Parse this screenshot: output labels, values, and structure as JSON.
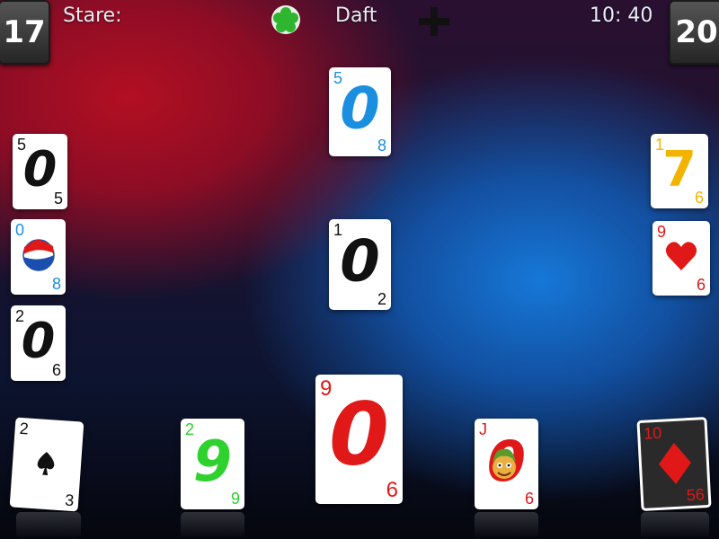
{
  "header": {
    "status_label": "Stare:",
    "player_name": "Daft",
    "clock": "10: 40"
  },
  "scores": {
    "left": "17",
    "right": "20"
  },
  "icons": {
    "status": "green-flower-icon",
    "add": "plus-icon"
  },
  "colors": {
    "black": "#111111",
    "blue": "#1a8fe0",
    "red": "#e01818",
    "green": "#2ed12e",
    "yellow": "#f2b400"
  },
  "cards": {
    "top_center": {
      "top": "5",
      "center": "0",
      "bottom": "8"
    },
    "center": {
      "top": "1",
      "center": "0",
      "bottom": "2"
    },
    "left_1": {
      "top": "5",
      "center": "0",
      "bottom": "5"
    },
    "left_2": {
      "top": "0",
      "center": "pepsi-logo",
      "bottom": "8"
    },
    "left_3": {
      "top": "2",
      "center": "0",
      "bottom": "6"
    },
    "right_1": {
      "top": "1",
      "center": "7",
      "bottom": "6"
    },
    "right_2": {
      "top": "9",
      "center": "heart",
      "bottom": "6"
    },
    "hand_1": {
      "top": "2",
      "center": "spade",
      "bottom": "3"
    },
    "hand_2": {
      "top": "2",
      "center": "9",
      "bottom": "9"
    },
    "hand_3": {
      "top": "9",
      "center": "0",
      "bottom": "6"
    },
    "hand_4": {
      "top": "J",
      "center": "0",
      "bottom": "6"
    },
    "hand_5": {
      "top": "10",
      "center": "diamond",
      "bottom": "56"
    }
  }
}
